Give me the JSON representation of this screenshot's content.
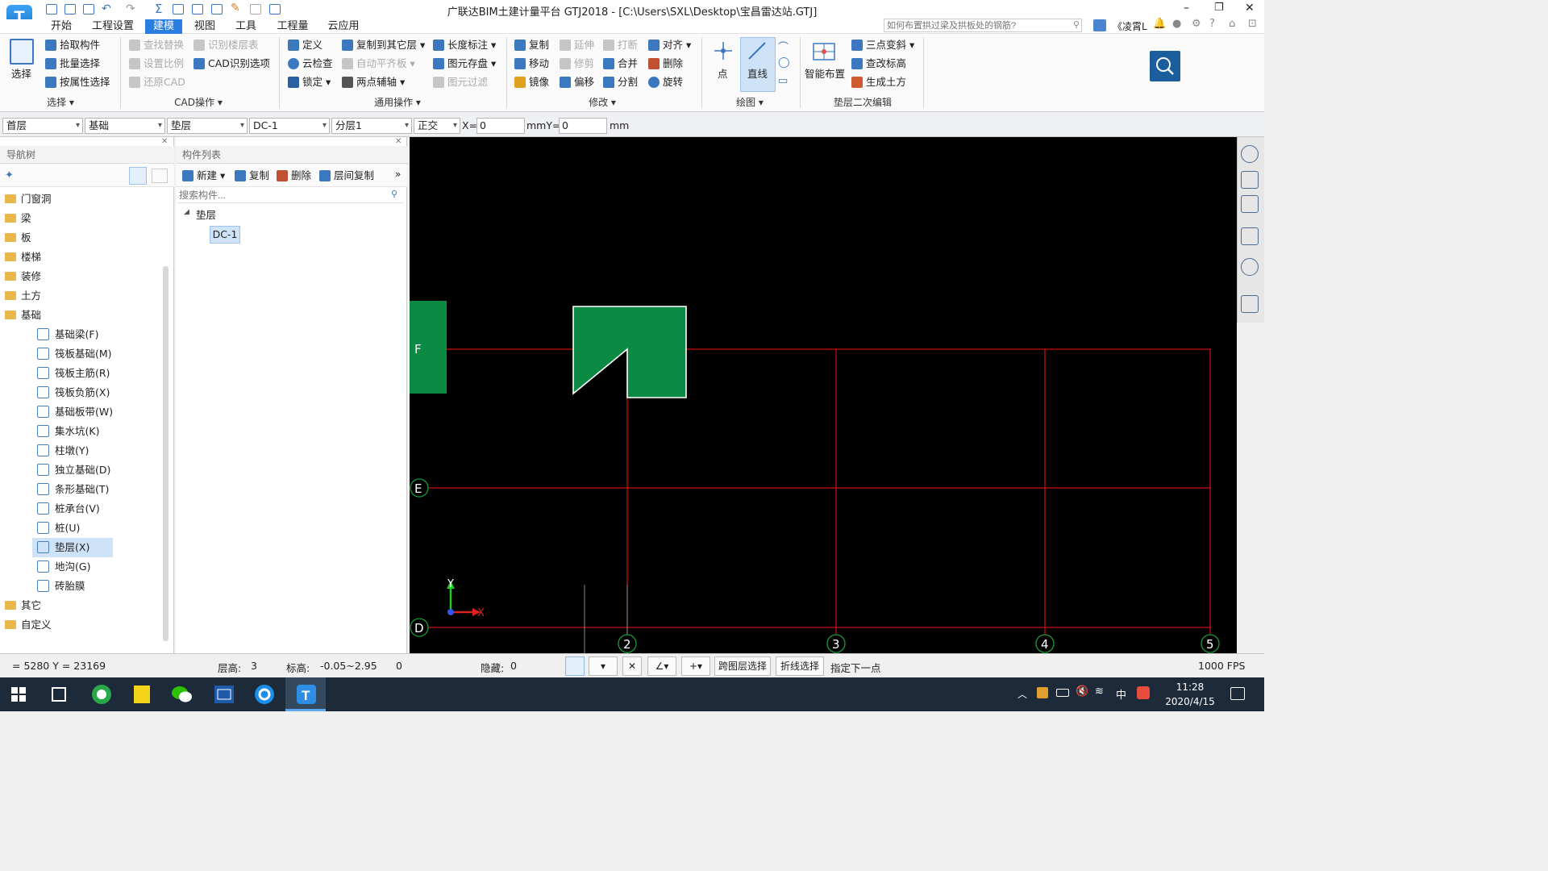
{
  "window": {
    "title": "广联达BIM土建计量平台 GTJ2018 - [C:\\Users\\SXL\\Desktop\\宝昌雷达站.GTJ]",
    "logo": "T"
  },
  "menu": [
    "开始",
    "工程设置",
    "建模",
    "视图",
    "工具",
    "工程量",
    "云应用"
  ],
  "search": {
    "placeholder": "如何布置拱过梁及拱板处的钢筋?",
    "user": "《凌霄L"
  },
  "ribbon": {
    "select": {
      "big": "选择",
      "items": [
        "拾取构件",
        "批量选择",
        "按属性选择"
      ],
      "group": "选择"
    },
    "cad": {
      "items": [
        "查找替换",
        "设置比例",
        "还原CAD",
        "识别楼层表",
        "CAD识别选项"
      ],
      "group": "CAD操作"
    },
    "common": {
      "items": [
        "定义",
        "云检查",
        "锁定",
        "复制到其它层",
        "自动平齐板",
        "两点辅轴",
        "长度标注",
        "图元存盘",
        "图元过滤"
      ],
      "group": "通用操作"
    },
    "modify": {
      "items": [
        "复制",
        "移动",
        "镜像",
        "延伸",
        "修剪",
        "偏移",
        "打断",
        "合并",
        "分割",
        "对齐",
        "删除",
        "旋转"
      ],
      "group": "修改"
    },
    "draw": {
      "point": "点",
      "line": "直线",
      "group": "绘图"
    },
    "cushion": {
      "big": "智能布置",
      "items": [
        "三点变斜",
        "查改标高",
        "生成土方"
      ],
      "group": "垫层二次编辑"
    }
  },
  "props": {
    "floor": "首层",
    "category": "基础",
    "type": "垫层",
    "component": "DC-1",
    "layer": "分层1",
    "mode": "正交",
    "x_label": "X=",
    "x_value": "0",
    "y_label": "mmY=",
    "y_value": "0",
    "unit": "mm"
  },
  "nav": {
    "title": "导航树",
    "items": [
      {
        "label": "门窗洞",
        "type": "folder"
      },
      {
        "label": "梁",
        "type": "folder"
      },
      {
        "label": "板",
        "type": "folder"
      },
      {
        "label": "楼梯",
        "type": "folder"
      },
      {
        "label": "装修",
        "type": "folder"
      },
      {
        "label": "土方",
        "type": "folder"
      },
      {
        "label": "基础",
        "type": "folder-open"
      },
      {
        "label": "基础梁(F)",
        "type": "child"
      },
      {
        "label": "筏板基础(M)",
        "type": "child"
      },
      {
        "label": "筏板主筋(R)",
        "type": "child"
      },
      {
        "label": "筏板负筋(X)",
        "type": "child"
      },
      {
        "label": "基础板带(W)",
        "type": "child"
      },
      {
        "label": "集水坑(K)",
        "type": "child"
      },
      {
        "label": "柱墩(Y)",
        "type": "child"
      },
      {
        "label": "独立基础(D)",
        "type": "child"
      },
      {
        "label": "条形基础(T)",
        "type": "child"
      },
      {
        "label": "桩承台(V)",
        "type": "child"
      },
      {
        "label": "桩(U)",
        "type": "child"
      },
      {
        "label": "垫层(X)",
        "type": "child-selected"
      },
      {
        "label": "地沟(G)",
        "type": "child"
      },
      {
        "label": "砖胎膜",
        "type": "child"
      },
      {
        "label": "其它",
        "type": "folder"
      },
      {
        "label": "自定义",
        "type": "folder"
      }
    ]
  },
  "components": {
    "title": "构件列表",
    "toolbar": [
      "新建",
      "复制",
      "删除",
      "层间复制"
    ],
    "search_placeholder": "搜索构件...",
    "group": "垫层",
    "selected": "DC-1"
  },
  "grid": {
    "rows": [
      "F",
      "E",
      "D"
    ],
    "cols": [
      "2",
      "3",
      "4",
      "5"
    ],
    "line_color": "#cc1111",
    "fill_color": "#0b8a43",
    "axis_x": "X",
    "axis_y": "Y"
  },
  "status": {
    "coords": "= 5280 Y = 23169",
    "floor_height_label": "层高:",
    "floor_height": "3",
    "elev_label": "标高:",
    "elev": "-0.05~2.95",
    "count": "0",
    "hidden_label": "隐藏:",
    "hidden": "0",
    "cross_select": "跨图层选择",
    "polyline_select": "折线选择",
    "prompt": "指定下一点",
    "fps": "1000 FPS"
  },
  "taskbar": {
    "time": "11:28",
    "date": "2020/4/15",
    "ime": "中"
  }
}
